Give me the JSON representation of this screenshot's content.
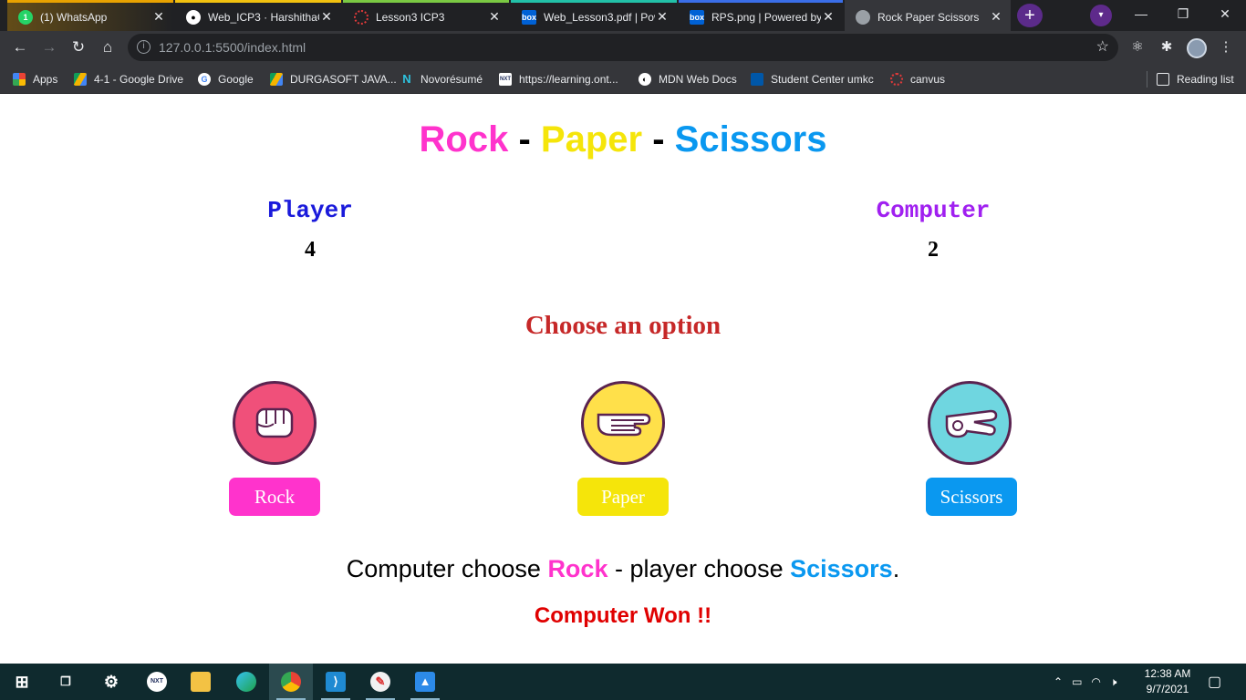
{
  "browser": {
    "tabs": [
      {
        "title": "(1) WhatsApp",
        "icon": "whatsapp-icon",
        "color": "#25d366"
      },
      {
        "title": "Web_ICP3 · HarshithaG",
        "icon": "github-icon",
        "color": "#ffffff"
      },
      {
        "title": "Lesson3 ICP3",
        "icon": "canvas-icon",
        "color": "#e13a3a"
      },
      {
        "title": "Web_Lesson3.pdf | Pow",
        "icon": "box-icon",
        "color": "#0061d5"
      },
      {
        "title": "RPS.png | Powered by",
        "icon": "box-icon",
        "color": "#0061d5"
      },
      {
        "title": "Rock Paper Scissors",
        "icon": "globe-icon",
        "color": "#9aa0a6"
      }
    ],
    "url": "127.0.0.1:5500/index.html",
    "bookmarks": [
      {
        "label": "Apps",
        "icon": "apps-grid-icon"
      },
      {
        "label": "4-1 - Google Drive",
        "icon": "google-drive-icon"
      },
      {
        "label": "Google",
        "icon": "google-icon"
      },
      {
        "label": "DURGASOFT JAVA...",
        "icon": "google-drive-icon"
      },
      {
        "label": "Novorésumé",
        "icon": "novoresume-icon"
      },
      {
        "label": "https://learning.ont...",
        "icon": "nxt-wave-icon"
      },
      {
        "label": "MDN Web Docs",
        "icon": "mdn-icon"
      },
      {
        "label": "Student Center umkc",
        "icon": "umkc-icon"
      },
      {
        "label": "canvus",
        "icon": "canvas-icon"
      }
    ],
    "reading_list": "Reading list"
  },
  "game": {
    "title": {
      "rock": "Rock",
      "sep1": "-",
      "paper": "Paper",
      "sep2": "-",
      "scissors": "Scissors"
    },
    "player": {
      "label": "Player",
      "score": "4"
    },
    "computer": {
      "label": "Computer",
      "score": "2"
    },
    "choose_heading": "Choose an option",
    "options": [
      {
        "label": "Rock",
        "color": "#ff33cc",
        "ring": "#f0507a"
      },
      {
        "label": "Paper",
        "color": "#f5e50a",
        "ring": "#ffe04a"
      },
      {
        "label": "Scissors",
        "color": "#0a98f0",
        "ring": "#6fd6e0"
      }
    ],
    "result": {
      "prefix": "Computer choose",
      "computer_choice": "Rock",
      "middle": "- player choose",
      "player_choice": "Scissors",
      "suffix": "."
    },
    "winner": "Computer Won !!",
    "colors": {
      "rock": "#ff33cc",
      "paper": "#f5e50a",
      "scissors": "#0a98f0",
      "player": "#1a1adb",
      "computer": "#a020f0",
      "heading": "#c62828",
      "winner": "#e00000"
    }
  },
  "taskbar": {
    "clock_time": "12:38 AM",
    "clock_date": "9/7/2021"
  }
}
